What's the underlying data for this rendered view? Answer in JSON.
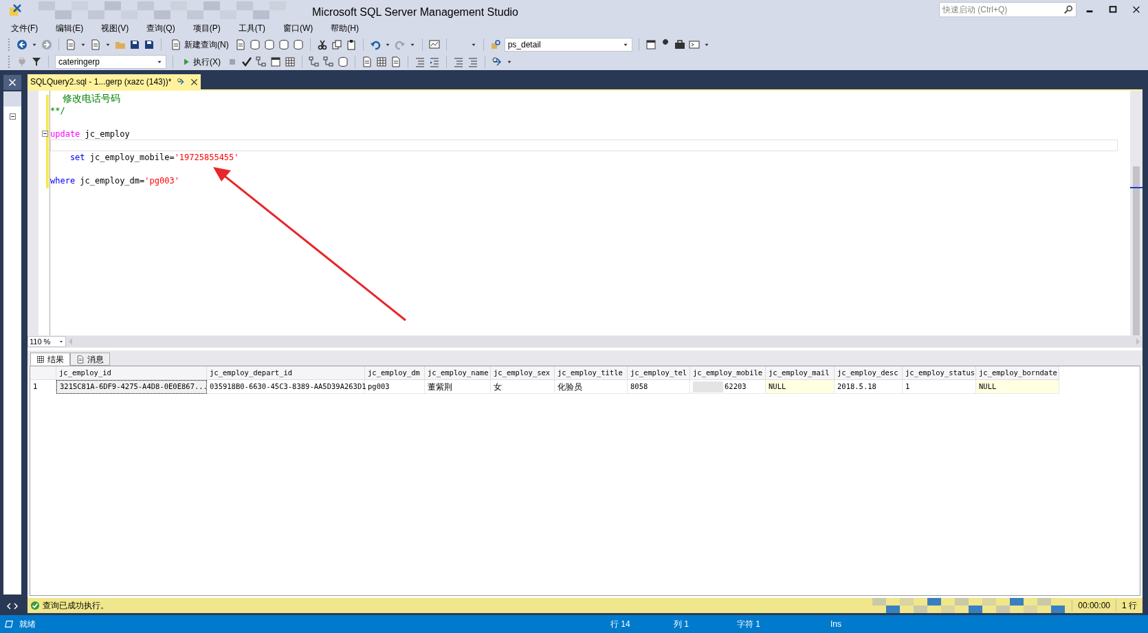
{
  "window": {
    "title": "Microsoft SQL Server Management Studio"
  },
  "quick_launch": {
    "placeholder": "快速启动 (Ctrl+Q)"
  },
  "menu": [
    "文件(F)",
    "编辑(E)",
    "视图(V)",
    "查询(Q)",
    "项目(P)",
    "工具(T)",
    "窗口(W)",
    "帮助(H)"
  ],
  "toolbar": {
    "new_query": "新建查询(N)",
    "solution_config": "ps_detail"
  },
  "sql_toolbar": {
    "database": "cateringerp",
    "execute": "执行(X)"
  },
  "document_tabs": [
    {
      "label": "SQLQuery2.sql - 1...gerp (xazc (143))*",
      "selected": true
    }
  ],
  "editor": {
    "lines": [
      {
        "tokens": [
          {
            "kind": "comment",
            "text": "    修改电话号码"
          }
        ]
      },
      {
        "tokens": [
          {
            "kind": "comment",
            "text": "**/"
          }
        ]
      },
      {
        "kind": "blank"
      },
      {
        "fold": true,
        "tokens": [
          {
            "kind": "dml",
            "text": "update"
          },
          {
            "kind": "plain",
            "text": " jc_employ"
          }
        ]
      },
      {
        "current": true
      },
      {
        "tokens": [
          {
            "kind": "keyword",
            "text": "    set"
          },
          {
            "kind": "plain",
            "text": " jc_employ_mobile="
          },
          {
            "kind": "string",
            "text": "'19725855455'"
          }
        ]
      },
      {
        "kind": "blank"
      },
      {
        "tokens": [
          {
            "kind": "keyword",
            "text": "where"
          },
          {
            "kind": "plain",
            "text": " jc_employ_dm="
          },
          {
            "kind": "string",
            "text": "'pg003'"
          }
        ]
      }
    ],
    "zoom": "110 %"
  },
  "result_tabs": [
    {
      "label": "结果",
      "selected": true
    },
    {
      "label": "消息",
      "selected": false
    }
  ],
  "results": {
    "columns": [
      "jc_employ_id",
      "jc_employ_depart_id",
      "jc_employ_dm",
      "jc_employ_name",
      "jc_employ_sex",
      "jc_employ_title",
      "jc_employ_tel",
      "jc_employ_mobile",
      "jc_employ_mail",
      "jc_employ_desc",
      "jc_employ_status",
      "jc_employ_borndate"
    ],
    "rows": [
      {
        "number": "1",
        "cells": [
          {
            "text": "3215C81A-6DF9-4275-A4D8-0E0E867...",
            "kind": "value",
            "selected": true
          },
          {
            "text": "035918B0-6630-45C3-8389-AA5D39A263D1",
            "kind": "value",
            "selected": false
          },
          {
            "text": "pg003",
            "kind": "value",
            "selected": false
          },
          {
            "text": "董紫荆",
            "kind": "value",
            "selected": false
          },
          {
            "text": "女",
            "kind": "value",
            "selected": false
          },
          {
            "text": "化验员",
            "kind": "value",
            "selected": false
          },
          {
            "text": "8058",
            "kind": "value",
            "selected": false
          },
          {
            "text": "62203",
            "kind": "redacted",
            "selected": false
          },
          {
            "text": "NULL",
            "kind": "null",
            "selected": false
          },
          {
            "text": "2018.5.18",
            "kind": "value",
            "selected": false
          },
          {
            "text": "1",
            "kind": "value",
            "selected": false
          },
          {
            "text": "NULL",
            "kind": "null",
            "selected": false
          }
        ]
      }
    ]
  },
  "query_status": {
    "message": "查询已成功执行。",
    "elapsed": "00:00:00",
    "rows": "1 行"
  },
  "status_bar": {
    "state": "就绪",
    "line": "行 14",
    "column": "列 1",
    "char": "字符 1",
    "mode": "Ins"
  }
}
